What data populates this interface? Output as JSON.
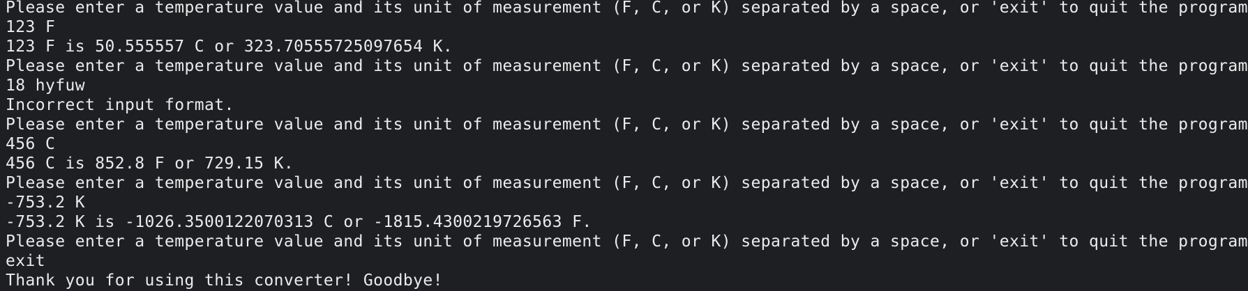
{
  "terminal": {
    "lines": [
      "Please enter a temperature value and its unit of measurement (F, C, or K) separated by a space, or 'exit' to quit the program.",
      "123 F",
      "123 F is 50.555557 C or 323.70555725097654 K.",
      "Please enter a temperature value and its unit of measurement (F, C, or K) separated by a space, or 'exit' to quit the program.",
      "18 hyfuw",
      "Incorrect input format.",
      "Please enter a temperature value and its unit of measurement (F, C, or K) separated by a space, or 'exit' to quit the program.",
      "456 C",
      "456 C is 852.8 F or 729.15 K.",
      "Please enter a temperature value and its unit of measurement (F, C, or K) separated by a space, or 'exit' to quit the program.",
      "-753.2 K",
      "-753.2 K is -1026.3500122070313 C or -1815.4300219726563 F.",
      "Please enter a temperature value and its unit of measurement (F, C, or K) separated by a space, or 'exit' to quit the program.",
      "exit",
      "Thank you for using this converter! Goodbye!"
    ],
    "colors": {
      "background": "#1e1f22",
      "text": "#ebebeb"
    }
  }
}
